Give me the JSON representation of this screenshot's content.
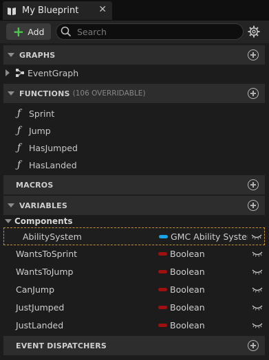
{
  "tab": {
    "title": "My Blueprint",
    "close": "✕"
  },
  "toolbar": {
    "add_label": "Add",
    "search_placeholder": "Search"
  },
  "sections": {
    "graphs": "GRAPHS",
    "functions": "FUNCTIONS",
    "functions_sub": "(106 OVERRIDABLE)",
    "macros": "MACROS",
    "variables": "VARIABLES",
    "dispatchers": "EVENT DISPATCHERS"
  },
  "graphs": [
    {
      "label": "EventGraph"
    }
  ],
  "functions": [
    {
      "label": "Sprint"
    },
    {
      "label": "Jump"
    },
    {
      "label": "HasJumped"
    },
    {
      "label": "HasLanded"
    }
  ],
  "function_icon": "ƒ",
  "variables": {
    "category": "Components",
    "items": [
      {
        "name": "AbilitySystem",
        "type": "GMC Ability Syster",
        "color": "#1aa3e6",
        "selected": true
      },
      {
        "name": "WantsToSprint",
        "type": "Boolean",
        "color": "#a01010"
      },
      {
        "name": "WantsToJump",
        "type": "Boolean",
        "color": "#a01010"
      },
      {
        "name": "CanJump",
        "type": "Boolean",
        "color": "#a01010"
      },
      {
        "name": "JustJumped",
        "type": "Boolean",
        "color": "#a01010"
      },
      {
        "name": "JustLanded",
        "type": "Boolean",
        "color": "#a01010"
      }
    ]
  },
  "colors": {
    "accent_add": "#4cc84c",
    "selection_border": "#c8962a",
    "bool_pill": "#a01010",
    "object_pill": "#1aa3e6"
  }
}
